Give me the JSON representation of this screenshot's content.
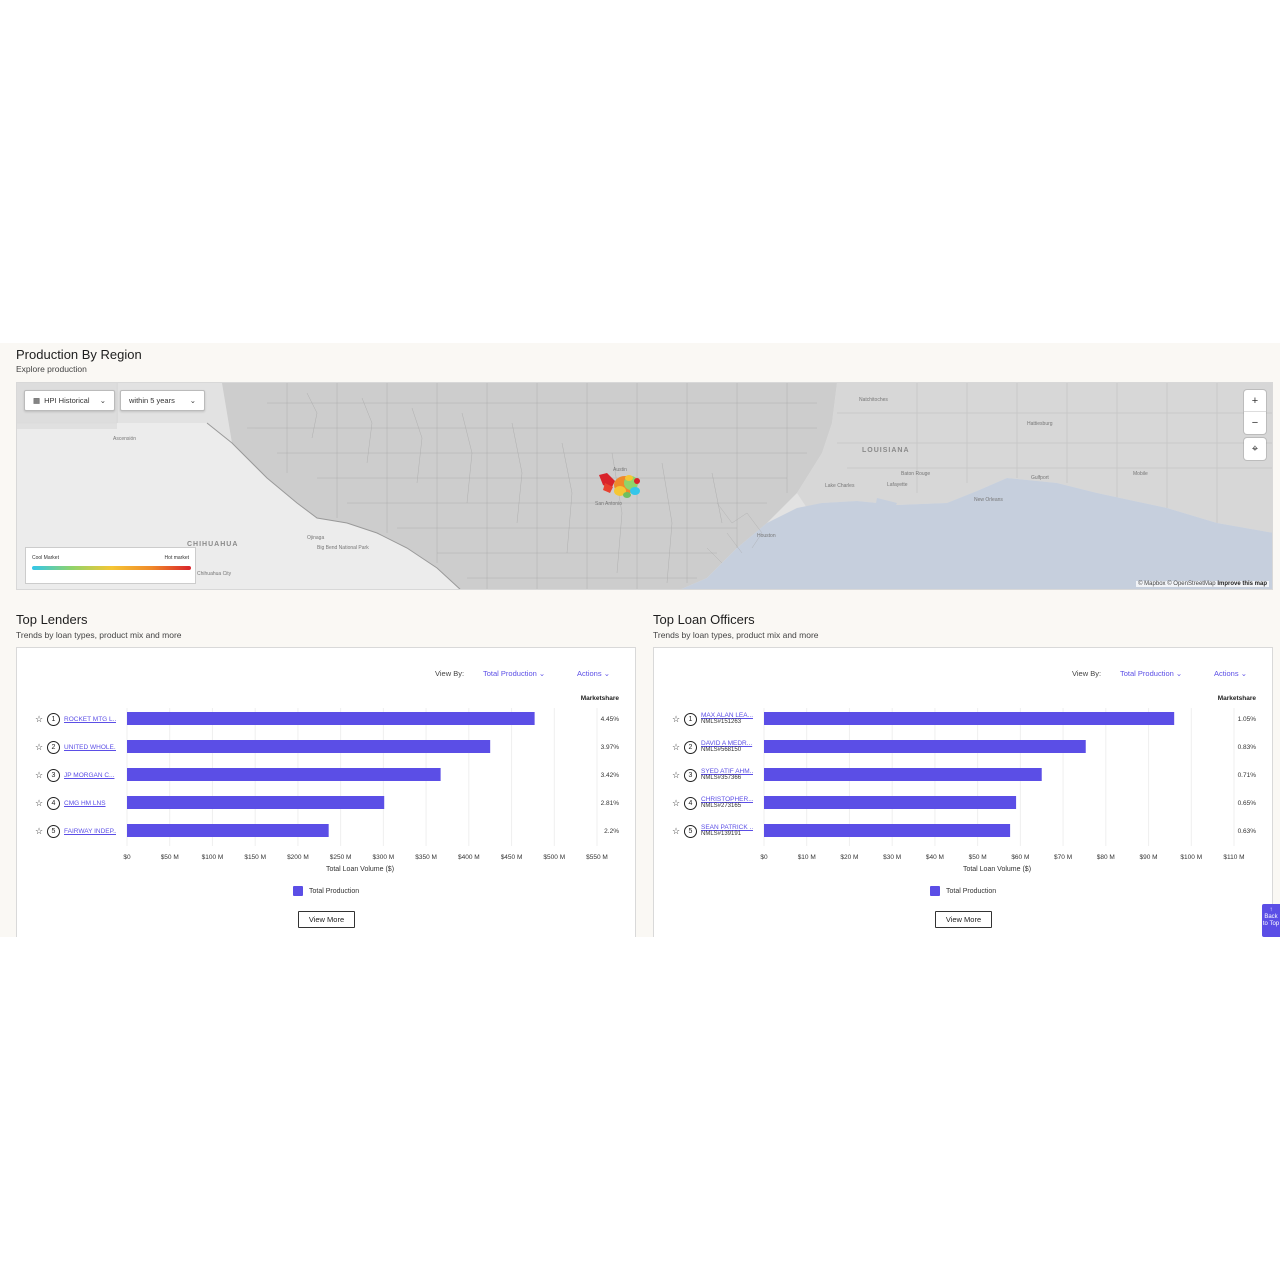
{
  "region": {
    "title": "Production By Region",
    "subtitle": "Explore production",
    "layer_select": "HPI Historical",
    "range_select": "within 5 years",
    "zoom_in": "+",
    "zoom_out": "−",
    "legend_cool": "Cool Market",
    "legend_hot": "Hot market",
    "attribution": "© Mapbox © OpenStreetMap",
    "improve": "Improve this map",
    "places": [
      "Natchitoches",
      "Hattiesburg",
      "LOUISIANA",
      "Baton Rouge",
      "Lafayette",
      "Lake Charles",
      "New Orleans",
      "Gulfport",
      "Mobile",
      "Houston",
      "San Antonio",
      "Austin",
      "CHIHUAHUA",
      "Chihuahua City",
      "Ascensión",
      "Ojinaga",
      "Big Bend National Park"
    ]
  },
  "lenders": {
    "title": "Top Lenders",
    "subtitle": "Trends by loan types, product mix and more",
    "view_by_label": "View By:",
    "view_by_value": "Total Production",
    "actions": "Actions",
    "marketshare_header": "Marketshare",
    "x_label": "Total Loan Volume ($)",
    "legend": "Total Production",
    "view_more": "View More",
    "rows": [
      {
        "rank": "1",
        "name": "ROCKET MTG L...",
        "share": "4.45%"
      },
      {
        "rank": "2",
        "name": "UNITED WHOLE...",
        "share": "3.97%"
      },
      {
        "rank": "3",
        "name": "JP MORGAN C...",
        "share": "3.42%"
      },
      {
        "rank": "4",
        "name": "CMG HM LNS",
        "share": "2.81%"
      },
      {
        "rank": "5",
        "name": "FAIRWAY INDEP...",
        "share": "2.2%"
      }
    ]
  },
  "officers": {
    "title": "Top Loan Officers",
    "subtitle": "Trends by loan types, product mix and more",
    "view_by_label": "View By:",
    "view_by_value": "Total Production",
    "actions": "Actions",
    "marketshare_header": "Marketshare",
    "x_label": "Total Loan Volume ($)",
    "legend": "Total Production",
    "view_more": "View More",
    "rows": [
      {
        "rank": "1",
        "name": "MAX ALAN LEA...",
        "nmls": "NMLS#151263",
        "share": "1.05%"
      },
      {
        "rank": "2",
        "name": "DAVID A MEDR...",
        "nmls": "NMLS#568150",
        "share": "0.83%"
      },
      {
        "rank": "3",
        "name": "SYED ATIF AHM...",
        "nmls": "NMLS#357366",
        "share": "0.71%"
      },
      {
        "rank": "4",
        "name": "CHRISTOPHER...",
        "nmls": "NMLS#273165",
        "share": "0.65%"
      },
      {
        "rank": "5",
        "name": "SEAN PATRICK ...",
        "nmls": "NMLS#139191",
        "share": "0.63%"
      }
    ]
  },
  "chart_data": [
    {
      "type": "bar",
      "orientation": "horizontal",
      "categories": [
        "ROCKET MTG L...",
        "UNITED WHOLE...",
        "JP MORGAN C...",
        "CMG HM LNS",
        "FAIRWAY INDEP..."
      ],
      "series": [
        {
          "name": "Total Production",
          "values": [
            477,
            425,
            367,
            301,
            236
          ]
        }
      ],
      "unit": "$M",
      "xlabel": "Total Loan Volume ($)",
      "xlim": [
        0,
        550
      ],
      "ticks": [
        "$0",
        "$50 M",
        "$100 M",
        "$150 M",
        "$200 M",
        "$250 M",
        "$300 M",
        "$350 M",
        "$400 M",
        "$450 M",
        "$500 M",
        "$550 M"
      ],
      "bar_color": "#5b4ee6"
    },
    {
      "type": "bar",
      "orientation": "horizontal",
      "categories": [
        "MAX ALAN LEA...",
        "DAVID A MEDR...",
        "SYED ATIF AHM...",
        "CHRISTOPHER...",
        "SEAN PATRICK ..."
      ],
      "series": [
        {
          "name": "Total Production",
          "values": [
            96,
            75.3,
            65,
            59,
            57.6
          ]
        }
      ],
      "unit": "$M",
      "xlabel": "Total Loan Volume ($)",
      "xlim": [
        0,
        110
      ],
      "ticks": [
        "$0",
        "$10 M",
        "$20 M",
        "$30 M",
        "$40 M",
        "$50 M",
        "$60 M",
        "$70 M",
        "$80 M",
        "$90 M",
        "$100 M",
        "$110 M"
      ],
      "bar_color": "#5b4ee6"
    }
  ],
  "back_to_top": "Back to Top"
}
